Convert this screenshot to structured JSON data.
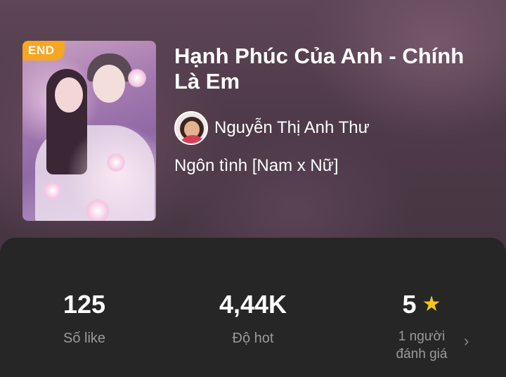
{
  "book": {
    "badge": "END",
    "title": "Hạnh Phúc Của Anh - Chính Là Em",
    "author": "Nguyễn Thị Anh Thư",
    "genre": "Ngôn tình [Nam x Nữ]"
  },
  "stats": {
    "likes": {
      "value": "125",
      "label": "Số like"
    },
    "hot": {
      "value": "4,44K",
      "label": "Độ hot"
    },
    "rating": {
      "value": "5",
      "label_line1": "1 người",
      "label_line2": "đánh giá",
      "icon": "star-icon"
    }
  },
  "colors": {
    "badge": "#f5a623",
    "star": "#f5c518",
    "panel": "#262626"
  }
}
